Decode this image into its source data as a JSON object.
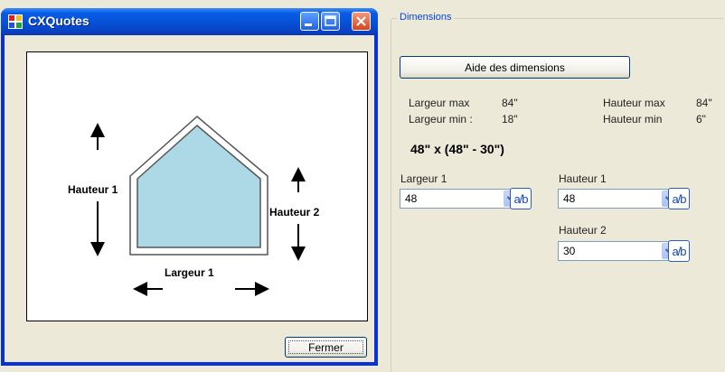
{
  "window": {
    "title": "CXQuotes",
    "close_button": "Fermer"
  },
  "diagram": {
    "height1_label": "Hauteur 1",
    "height2_label": "Hauteur 2",
    "width1_label": "Largeur 1",
    "fill_color": "#add8e6"
  },
  "panel": {
    "group_title": "Dimensions",
    "help_button": "Aide des dimensions",
    "width_max_label": "Largeur max",
    "width_max_value": "84\"",
    "width_min_label": "Largeur min :",
    "width_min_value": "18\"",
    "height_max_label": "Hauteur max",
    "height_max_value": "84\"",
    "height_min_label": "Hauteur min",
    "height_min_value": "6\"",
    "formula": "48\" x (48\" - 30\")",
    "fields": [
      {
        "label": "Largeur 1",
        "value": "48"
      },
      {
        "label": "Hauteur 1",
        "value": "48"
      },
      {
        "label": "Hauteur 2",
        "value": "30"
      }
    ],
    "fraction_button_label": "a/b"
  }
}
